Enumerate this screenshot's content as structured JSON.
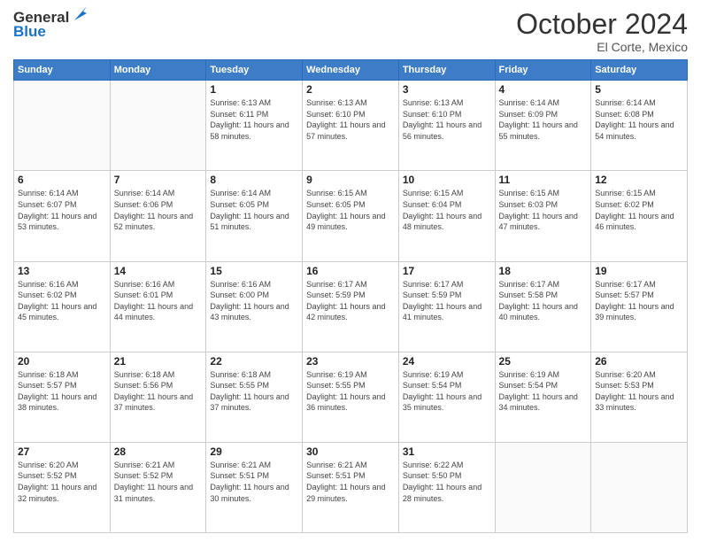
{
  "header": {
    "logo_line1": "General",
    "logo_line2": "Blue",
    "month": "October 2024",
    "location": "El Corte, Mexico"
  },
  "weekdays": [
    "Sunday",
    "Monday",
    "Tuesday",
    "Wednesday",
    "Thursday",
    "Friday",
    "Saturday"
  ],
  "weeks": [
    [
      {
        "day": "",
        "sunrise": "",
        "sunset": "",
        "daylight": ""
      },
      {
        "day": "",
        "sunrise": "",
        "sunset": "",
        "daylight": ""
      },
      {
        "day": "1",
        "sunrise": "Sunrise: 6:13 AM",
        "sunset": "Sunset: 6:11 PM",
        "daylight": "Daylight: 11 hours and 58 minutes."
      },
      {
        "day": "2",
        "sunrise": "Sunrise: 6:13 AM",
        "sunset": "Sunset: 6:10 PM",
        "daylight": "Daylight: 11 hours and 57 minutes."
      },
      {
        "day": "3",
        "sunrise": "Sunrise: 6:13 AM",
        "sunset": "Sunset: 6:10 PM",
        "daylight": "Daylight: 11 hours and 56 minutes."
      },
      {
        "day": "4",
        "sunrise": "Sunrise: 6:14 AM",
        "sunset": "Sunset: 6:09 PM",
        "daylight": "Daylight: 11 hours and 55 minutes."
      },
      {
        "day": "5",
        "sunrise": "Sunrise: 6:14 AM",
        "sunset": "Sunset: 6:08 PM",
        "daylight": "Daylight: 11 hours and 54 minutes."
      }
    ],
    [
      {
        "day": "6",
        "sunrise": "Sunrise: 6:14 AM",
        "sunset": "Sunset: 6:07 PM",
        "daylight": "Daylight: 11 hours and 53 minutes."
      },
      {
        "day": "7",
        "sunrise": "Sunrise: 6:14 AM",
        "sunset": "Sunset: 6:06 PM",
        "daylight": "Daylight: 11 hours and 52 minutes."
      },
      {
        "day": "8",
        "sunrise": "Sunrise: 6:14 AM",
        "sunset": "Sunset: 6:05 PM",
        "daylight": "Daylight: 11 hours and 51 minutes."
      },
      {
        "day": "9",
        "sunrise": "Sunrise: 6:15 AM",
        "sunset": "Sunset: 6:05 PM",
        "daylight": "Daylight: 11 hours and 49 minutes."
      },
      {
        "day": "10",
        "sunrise": "Sunrise: 6:15 AM",
        "sunset": "Sunset: 6:04 PM",
        "daylight": "Daylight: 11 hours and 48 minutes."
      },
      {
        "day": "11",
        "sunrise": "Sunrise: 6:15 AM",
        "sunset": "Sunset: 6:03 PM",
        "daylight": "Daylight: 11 hours and 47 minutes."
      },
      {
        "day": "12",
        "sunrise": "Sunrise: 6:15 AM",
        "sunset": "Sunset: 6:02 PM",
        "daylight": "Daylight: 11 hours and 46 minutes."
      }
    ],
    [
      {
        "day": "13",
        "sunrise": "Sunrise: 6:16 AM",
        "sunset": "Sunset: 6:02 PM",
        "daylight": "Daylight: 11 hours and 45 minutes."
      },
      {
        "day": "14",
        "sunrise": "Sunrise: 6:16 AM",
        "sunset": "Sunset: 6:01 PM",
        "daylight": "Daylight: 11 hours and 44 minutes."
      },
      {
        "day": "15",
        "sunrise": "Sunrise: 6:16 AM",
        "sunset": "Sunset: 6:00 PM",
        "daylight": "Daylight: 11 hours and 43 minutes."
      },
      {
        "day": "16",
        "sunrise": "Sunrise: 6:17 AM",
        "sunset": "Sunset: 5:59 PM",
        "daylight": "Daylight: 11 hours and 42 minutes."
      },
      {
        "day": "17",
        "sunrise": "Sunrise: 6:17 AM",
        "sunset": "Sunset: 5:59 PM",
        "daylight": "Daylight: 11 hours and 41 minutes."
      },
      {
        "day": "18",
        "sunrise": "Sunrise: 6:17 AM",
        "sunset": "Sunset: 5:58 PM",
        "daylight": "Daylight: 11 hours and 40 minutes."
      },
      {
        "day": "19",
        "sunrise": "Sunrise: 6:17 AM",
        "sunset": "Sunset: 5:57 PM",
        "daylight": "Daylight: 11 hours and 39 minutes."
      }
    ],
    [
      {
        "day": "20",
        "sunrise": "Sunrise: 6:18 AM",
        "sunset": "Sunset: 5:57 PM",
        "daylight": "Daylight: 11 hours and 38 minutes."
      },
      {
        "day": "21",
        "sunrise": "Sunrise: 6:18 AM",
        "sunset": "Sunset: 5:56 PM",
        "daylight": "Daylight: 11 hours and 37 minutes."
      },
      {
        "day": "22",
        "sunrise": "Sunrise: 6:18 AM",
        "sunset": "Sunset: 5:55 PM",
        "daylight": "Daylight: 11 hours and 37 minutes."
      },
      {
        "day": "23",
        "sunrise": "Sunrise: 6:19 AM",
        "sunset": "Sunset: 5:55 PM",
        "daylight": "Daylight: 11 hours and 36 minutes."
      },
      {
        "day": "24",
        "sunrise": "Sunrise: 6:19 AM",
        "sunset": "Sunset: 5:54 PM",
        "daylight": "Daylight: 11 hours and 35 minutes."
      },
      {
        "day": "25",
        "sunrise": "Sunrise: 6:19 AM",
        "sunset": "Sunset: 5:54 PM",
        "daylight": "Daylight: 11 hours and 34 minutes."
      },
      {
        "day": "26",
        "sunrise": "Sunrise: 6:20 AM",
        "sunset": "Sunset: 5:53 PM",
        "daylight": "Daylight: 11 hours and 33 minutes."
      }
    ],
    [
      {
        "day": "27",
        "sunrise": "Sunrise: 6:20 AM",
        "sunset": "Sunset: 5:52 PM",
        "daylight": "Daylight: 11 hours and 32 minutes."
      },
      {
        "day": "28",
        "sunrise": "Sunrise: 6:21 AM",
        "sunset": "Sunset: 5:52 PM",
        "daylight": "Daylight: 11 hours and 31 minutes."
      },
      {
        "day": "29",
        "sunrise": "Sunrise: 6:21 AM",
        "sunset": "Sunset: 5:51 PM",
        "daylight": "Daylight: 11 hours and 30 minutes."
      },
      {
        "day": "30",
        "sunrise": "Sunrise: 6:21 AM",
        "sunset": "Sunset: 5:51 PM",
        "daylight": "Daylight: 11 hours and 29 minutes."
      },
      {
        "day": "31",
        "sunrise": "Sunrise: 6:22 AM",
        "sunset": "Sunset: 5:50 PM",
        "daylight": "Daylight: 11 hours and 28 minutes."
      },
      {
        "day": "",
        "sunrise": "",
        "sunset": "",
        "daylight": ""
      },
      {
        "day": "",
        "sunrise": "",
        "sunset": "",
        "daylight": ""
      }
    ]
  ]
}
